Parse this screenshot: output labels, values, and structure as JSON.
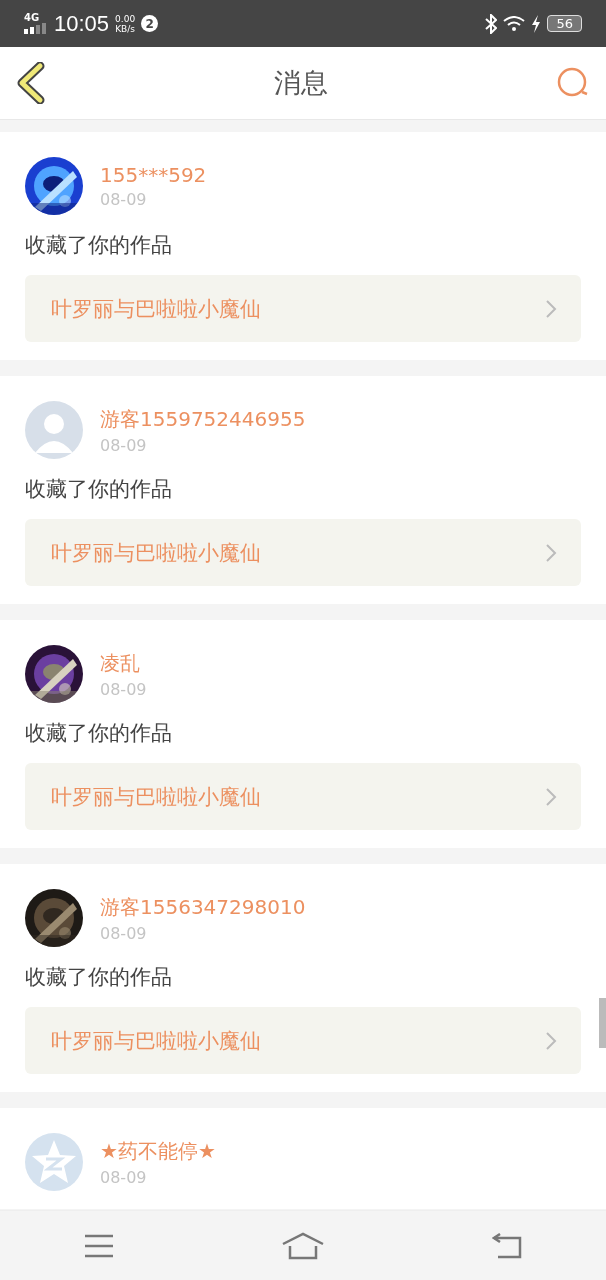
{
  "status_bar": {
    "network": "4G",
    "time": "10:05",
    "speed": "0.00",
    "speed_unit": "KB/s",
    "notification_count": "2",
    "battery": "56"
  },
  "header": {
    "title": "消息"
  },
  "messages": [
    {
      "user": "155***592",
      "date": "08-09",
      "action": "收藏了你的作品",
      "work": "叶罗丽与巴啦啦小魔仙"
    },
    {
      "user": "游客1559752446955",
      "date": "08-09",
      "action": "收藏了你的作品",
      "work": "叶罗丽与巴啦啦小魔仙",
      "avatar": {
        "kind": "silhouette"
      }
    },
    {
      "user": "凌乱",
      "date": "08-09",
      "action": "收藏了你的作品",
      "work": "叶罗丽与巴啦啦小魔仙"
    },
    {
      "user": "游客1556347298010",
      "date": "08-09",
      "action": "收藏了你的作品",
      "work": "叶罗丽与巴啦啦小魔仙"
    },
    {
      "user": "★药不能停★",
      "date": "08-09",
      "avatar": {
        "kind": "star"
      }
    }
  ]
}
